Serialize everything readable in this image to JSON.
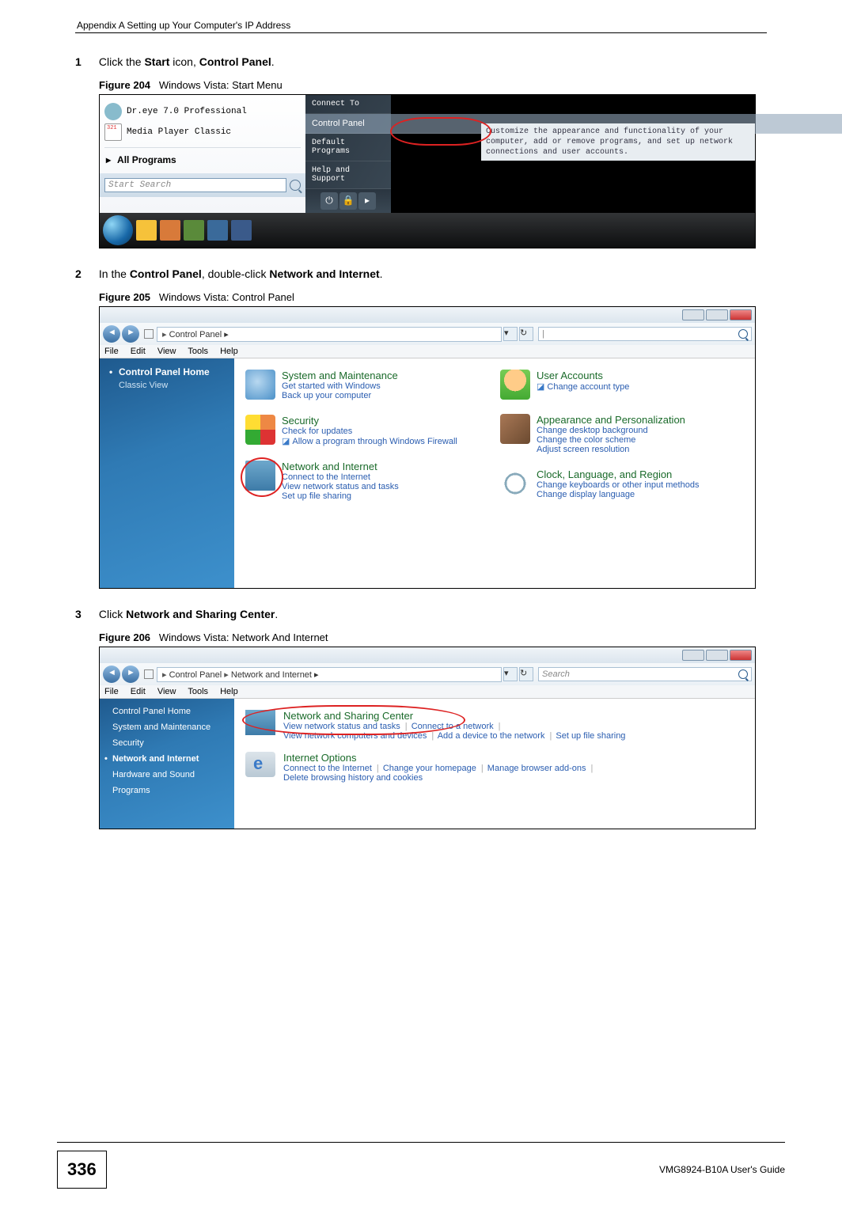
{
  "header": "Appendix A Setting up Your Computer's IP Address",
  "steps": {
    "s1": {
      "num": "1",
      "pre": "Click the ",
      "b1": "Start",
      "mid1": " icon, ",
      "b2": "Control Panel",
      "post": "."
    },
    "s2": {
      "num": "2",
      "pre": "In the ",
      "b1": "Control Panel",
      "mid1": ", double-click ",
      "b2": "Network and Internet",
      "post": "."
    },
    "s3": {
      "num": "3",
      "pre": "Click ",
      "b1": "Network and Sharing Center",
      "post": "."
    }
  },
  "figs": {
    "f204": {
      "label": "Figure 204",
      "caption": "Windows Vista: Start Menu"
    },
    "f205": {
      "label": "Figure 205",
      "caption": "Windows Vista: Control Panel"
    },
    "f206": {
      "label": "Figure 206",
      "caption": "Windows Vista: Network And Internet"
    }
  },
  "startmenu": {
    "recent1": "Dr.eye 7.0 Professional",
    "recent2": "Media Player Classic",
    "allprograms": "All Programs",
    "search_placeholder": "Start Search",
    "right": {
      "connect": "Connect To",
      "cp": "Control Panel",
      "defaults": "Default Programs",
      "help": "Help and Support"
    },
    "tooltip": "Customize the appearance and functionality of your computer, add or remove programs, and set up network connections and user accounts."
  },
  "controlpanel": {
    "crumb": "Control Panel",
    "menu": {
      "file": "File",
      "edit": "Edit",
      "view": "View",
      "tools": "Tools",
      "help": "Help"
    },
    "side": {
      "home": "Control Panel Home",
      "classic": "Classic View"
    },
    "cats": {
      "sys": {
        "t": "System and Maintenance",
        "l1": "Get started with Windows",
        "l2": "Back up your computer"
      },
      "sec": {
        "t": "Security",
        "l1": "Check for updates",
        "l2": "Allow a program through Windows Firewall"
      },
      "net": {
        "t": "Network and Internet",
        "l1": "Connect to the Internet",
        "l2": "View network status and tasks",
        "l3": "Set up file sharing"
      },
      "usr": {
        "t": "User Accounts",
        "l1": "Change account type"
      },
      "app": {
        "t": "Appearance and Personalization",
        "l1": "Change desktop background",
        "l2": "Change the color scheme",
        "l3": "Adjust screen resolution"
      },
      "clk": {
        "t": "Clock, Language, and Region",
        "l1": "Change keyboards or other input methods",
        "l2": "Change display language"
      }
    }
  },
  "netinternet": {
    "crumb1": "Control Panel",
    "crumb2": "Network and Internet",
    "search_placeholder": "Search",
    "menu": {
      "file": "File",
      "edit": "Edit",
      "view": "View",
      "tools": "Tools",
      "help": "Help"
    },
    "side": {
      "home": "Control Panel Home",
      "sys": "System and Maintenance",
      "sec": "Security",
      "net": "Network and Internet",
      "hw": "Hardware and Sound",
      "prog": "Programs"
    },
    "nsc": {
      "t": "Network and Sharing Center",
      "l1": "View network status and tasks",
      "l2": "Connect to a network",
      "l3": "View network computers and devices",
      "l4": "Add a device to the network",
      "l5": "Set up file sharing"
    },
    "io": {
      "t": "Internet Options",
      "l1": "Connect to the Internet",
      "l2": "Change your homepage",
      "l3": "Manage browser add-ons",
      "l4": "Delete browsing history and cookies"
    }
  },
  "footer": {
    "page": "336",
    "guide": "VMG8924-B10A User's Guide"
  }
}
